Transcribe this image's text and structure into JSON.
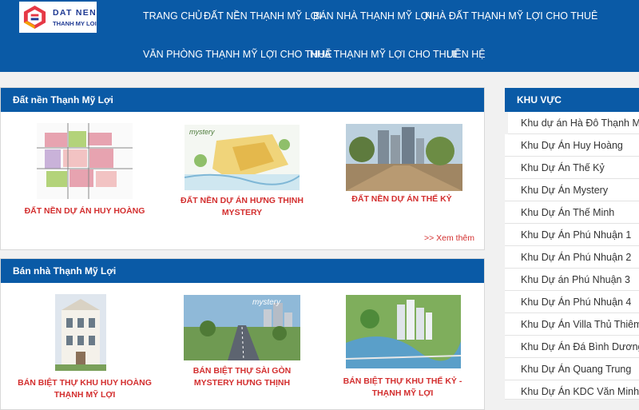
{
  "logo": {
    "line1": "DAT NEN",
    "line2": "THANH MY LOI"
  },
  "nav": [
    {
      "label": "TRANG CHỦ"
    },
    {
      "label": "ĐẤT NỀN THẠNH MỸ LỢI"
    },
    {
      "label": "BÁN NHÀ THẠNH MỸ LỢI"
    },
    {
      "label": "NHÀ ĐẤT THẠNH MỸ LỢI CHO THUÊ"
    },
    {
      "label": "VĂN PHÒNG THẠNH MỸ LỢI CHO THUÊ"
    },
    {
      "label": "NHÀ THẠNH MỸ LỢI CHO THUÊ"
    },
    {
      "label": "LIÊN HỆ"
    }
  ],
  "section1": {
    "title": "Đất nền Thạnh Mỹ Lợi",
    "items": [
      {
        "caption": "ĐẤT NỀN DỰ ÁN HUY HOÀNG"
      },
      {
        "caption": "ĐẤT NỀN DỰ ÁN HƯNG THỊNH MYSTERY"
      },
      {
        "caption": "ĐẤT NỀN DỰ ÁN THẾ KỶ"
      }
    ],
    "more": ">> Xem thêm"
  },
  "section2": {
    "title": "Bán nhà Thạnh Mỹ Lợi",
    "items": [
      {
        "caption": "BÁN BIỆT THỰ KHU HUY HOÀNG THẠNH MỸ LỢI"
      },
      {
        "caption": "BÁN BIỆT THỰ SÀI GÒN MYSTERY HƯNG THỊNH"
      },
      {
        "caption": "BÁN BIỆT THỰ KHU THẾ KỶ - THẠNH MỸ LỢI"
      }
    ]
  },
  "sidebar": {
    "title": "KHU VỰC",
    "items": [
      "Khu dự án Hà Đô Thạnh Mỹ Lợi",
      "Khu Dự Án Huy Hoàng",
      "Khu Dự Án Thế Kỷ",
      "Khu Dự Án Mystery",
      "Khu Dự Án Thế Minh",
      "Khu Dự Án Phú Nhuận 1",
      "Khu Dự Án Phú Nhuận 2",
      "Khu Dự án Phú Nhuận 3",
      "Khu Dự Án Phú Nhuận 4",
      "Khu Dự Án Villa Thủ Thiêm",
      "Khu Dự Án Đá Bình Dương",
      "Khu Dự Án Quang Trung",
      "Khu Dự Án KDC Văn Minh"
    ]
  },
  "colors": {
    "primary": "#0a5aa6",
    "accent": "#d32f2f"
  }
}
